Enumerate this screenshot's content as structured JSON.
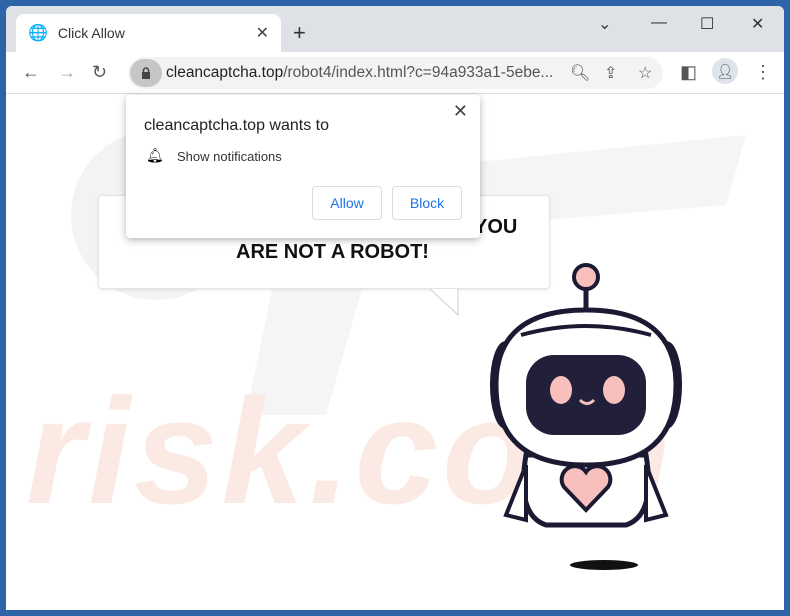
{
  "tab": {
    "title": "Click Allow",
    "icon": "globe-icon"
  },
  "address": {
    "domain": "cleancaptcha.top",
    "path": "/robot4/index.html?c=94a933a1-5ebe..."
  },
  "popup": {
    "heading": "cleancaptcha.top wants to",
    "permission": "Show notifications",
    "allow": "Allow",
    "block": "Block"
  },
  "page": {
    "line1": "YOU",
    "line2": "ARE NOT A ROBOT!",
    "watermark": "risk.com"
  }
}
